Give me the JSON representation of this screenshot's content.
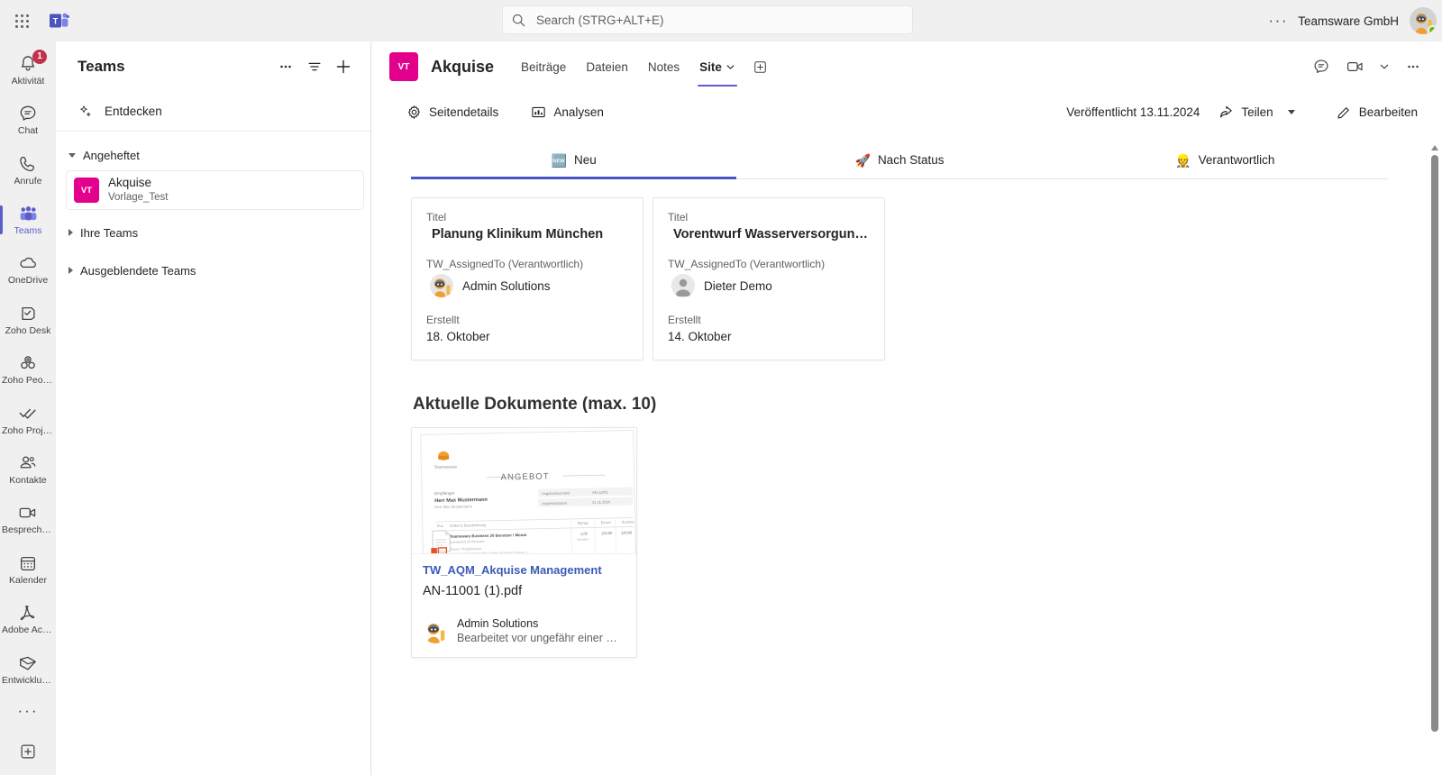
{
  "topbar": {
    "waffle_title": "App-Startfeld",
    "search_placeholder": "Search (STRG+ALT+E)",
    "search_value": "",
    "ellipsis": "···",
    "org_name": "Teamsware GmbH"
  },
  "rail": {
    "items": [
      {
        "label": "Aktivität",
        "icon": "bell-icon",
        "badge": "1",
        "active": false
      },
      {
        "label": "Chat",
        "icon": "chat-icon",
        "badge": "",
        "active": false
      },
      {
        "label": "Anrufe",
        "icon": "phone-icon",
        "badge": "",
        "active": false
      },
      {
        "label": "Teams",
        "icon": "teams-people-icon",
        "badge": "",
        "active": true
      },
      {
        "label": "OneDrive",
        "icon": "cloud-icon",
        "badge": "",
        "active": false
      },
      {
        "label": "Zoho Desk",
        "icon": "zoho-desk-icon",
        "badge": "",
        "active": false
      },
      {
        "label": "Zoho People",
        "icon": "zoho-people-icon",
        "badge": "",
        "active": false
      },
      {
        "label": "Zoho Proje...",
        "icon": "zoho-projects-icon",
        "badge": "",
        "active": false
      },
      {
        "label": "Kontakte",
        "icon": "contacts-icon",
        "badge": "",
        "active": false
      },
      {
        "label": "Besprechun...",
        "icon": "video-camera-icon",
        "badge": "",
        "active": false
      },
      {
        "label": "Kalender",
        "icon": "calendar-icon",
        "badge": "",
        "active": false
      },
      {
        "label": "Adobe Acro...",
        "icon": "adobe-acrobat-icon",
        "badge": "",
        "active": false
      },
      {
        "label": "Entwicklun...",
        "icon": "developer-portal-icon",
        "badge": "",
        "active": false
      }
    ],
    "more": "···",
    "add_app": "+"
  },
  "pane": {
    "title": "Teams",
    "more_label": "···",
    "filter_label": "Filter",
    "add_label": "+",
    "discover": "Entdecken",
    "groups": [
      {
        "name": "Angeheftet",
        "expanded": true
      },
      {
        "name": "Ihre Teams",
        "expanded": false
      },
      {
        "name": "Ausgeblendete Teams",
        "expanded": false
      }
    ],
    "pinned_team": {
      "initials": "VT",
      "name": "Akquise",
      "sub": "Vorlage_Test"
    }
  },
  "channel": {
    "avatar_initials": "VT",
    "title": "Akquise",
    "tabs": [
      {
        "label": "Beiträge",
        "active": false
      },
      {
        "label": "Dateien",
        "active": false
      },
      {
        "label": "Notes",
        "active": false
      },
      {
        "label": "Site",
        "active": true,
        "has_chevron": true
      }
    ],
    "add_tab": "+",
    "right_icons": [
      "chat-bubble-icon",
      "video-camera-icon",
      "chevron-down-icon",
      "more-horizontal-icon"
    ]
  },
  "spbar": {
    "page_details": "Seitendetails",
    "analytics": "Analysen",
    "published": "Veröffentlicht 13.11.2024",
    "share": "Teilen",
    "edit": "Bearbeiten"
  },
  "page": {
    "pivot": [
      {
        "label": "Neu",
        "emoji": "🆕",
        "active": true
      },
      {
        "label": "Nach Status",
        "emoji": "🚀",
        "active": false
      },
      {
        "label": "Verantwortlich",
        "emoji": "👷",
        "active": false
      }
    ],
    "cards": [
      {
        "title_label": "Titel",
        "title": "Planung Klinikum München",
        "assigned_label": "TW_AssignedTo (Verantwortlich)",
        "assigned_to": "Admin Solutions",
        "avatar_kind": "ninja-avatar",
        "created_label": "Erstellt",
        "created": "18. Oktober"
      },
      {
        "title_label": "Titel",
        "title": "Vorentwurf Wasserversorgung ...",
        "assigned_label": "TW_AssignedTo (Verantwortlich)",
        "assigned_to": "Dieter Demo",
        "avatar_kind": "generic-person-avatar",
        "created_label": "Erstellt",
        "created": "14. Oktober"
      }
    ],
    "documents_heading": "Aktuelle Dokumente (max. 10)",
    "documents": [
      {
        "site": "TW_AQM_Akquise Management",
        "filename": "AN-11001 (1).pdf",
        "author": "Admin Solutions",
        "modified": "Bearbeitet vor ungefähr einer St...",
        "thumbnail": {
          "brand": "Teamsware",
          "heading": "ANGEBOT",
          "recipient_label": "Empfänger",
          "recipient": "Herr Max Mustermann",
          "recipient_sub": "Herr Max Mustermann",
          "meta": [
            {
              "label": "Angebotsnummer",
              "value": "AN-11001"
            },
            {
              "label": "Angebotsdatum",
              "value": "21.11.2024"
            }
          ],
          "columns": [
            "Pos",
            "Artikel & Beschreibung",
            "Menge",
            "Einzel",
            "Summe"
          ],
          "rows": [
            {
              "desc": "Teamsware Business 20 Benutzer / Monat",
              "sub": "Lizenzpreis 20 Benutzer",
              "qty": "1,00",
              "unit": "120,00",
              "sum": "120,00"
            }
          ]
        }
      }
    ]
  },
  "colors": {
    "accent": "#5b5fc7",
    "pivot_accent": "#4a54c4",
    "team_avatar": "#e3008c",
    "badge": "#c4314b",
    "presence": "#6bb700",
    "link": "#3b5bb5"
  }
}
